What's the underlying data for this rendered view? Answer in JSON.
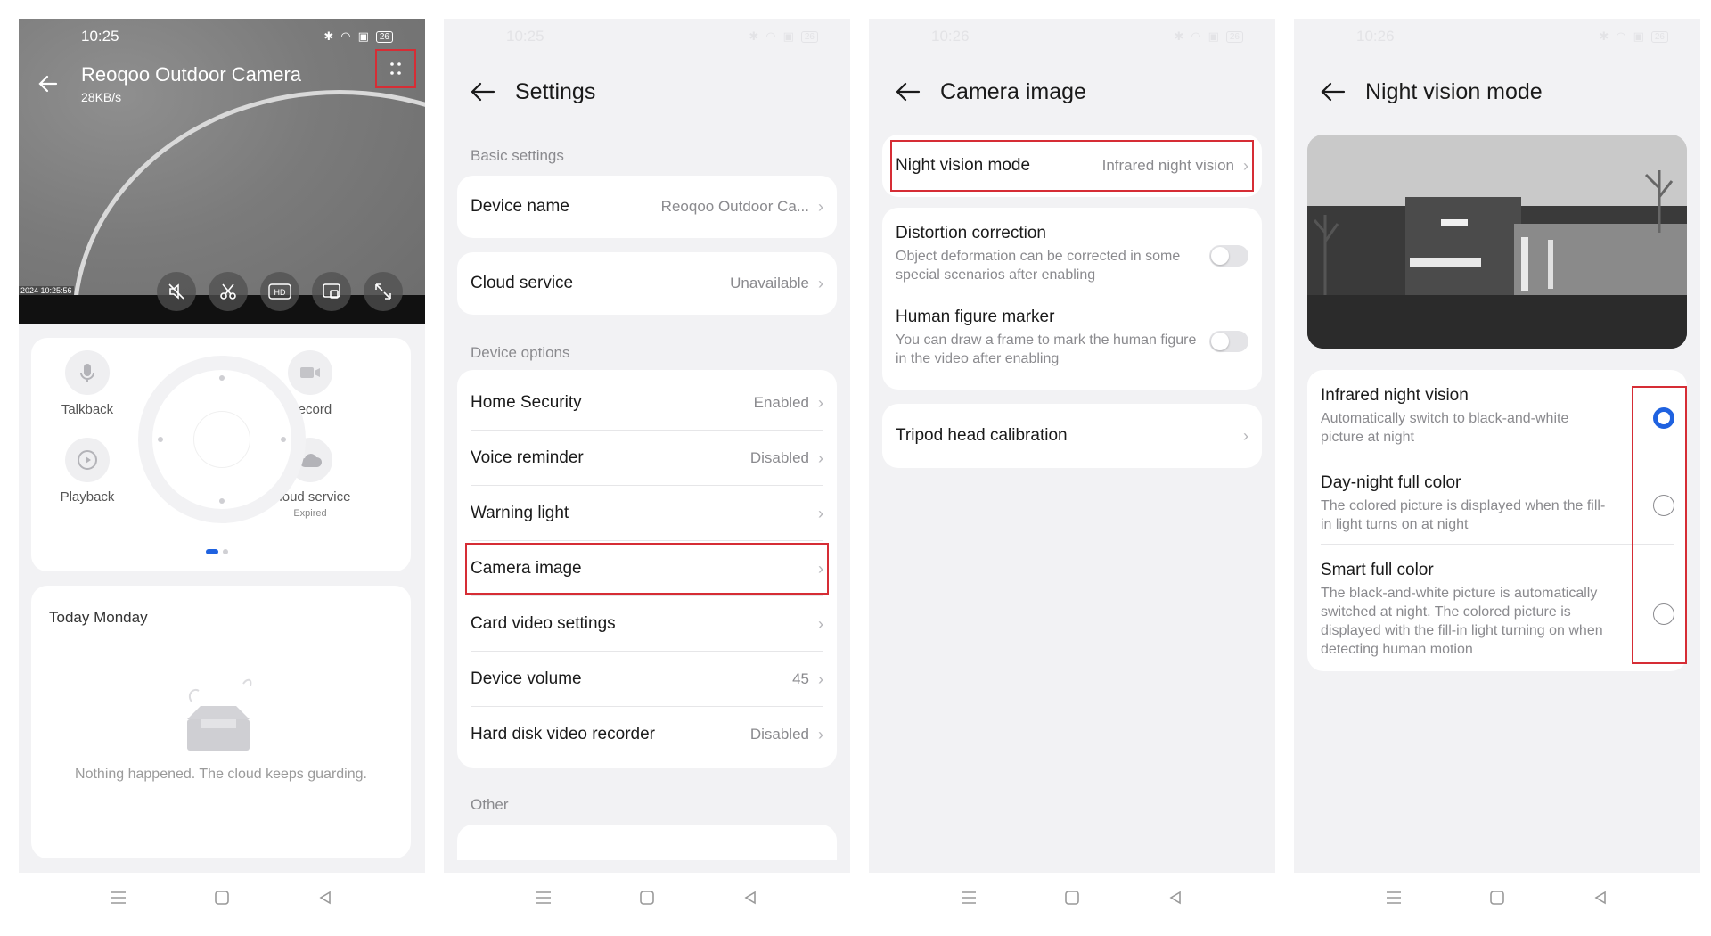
{
  "screen1": {
    "status": {
      "time": "10:25",
      "battery": "26"
    },
    "camera_title": "Reoqoo Outdoor Camera",
    "rate": "28KB/s",
    "timestamp": "2024  10:25:56",
    "hd_label": "HD",
    "features": {
      "talkback": "Talkback",
      "record": "Record",
      "playback": "Playback",
      "cloud_service": "Cloud service",
      "cloud_status": "Expired"
    },
    "today_label": "Today Monday",
    "empty_text": "Nothing happened. The cloud keeps guarding."
  },
  "screen2": {
    "status": {
      "time": "10:25",
      "battery": "26"
    },
    "title": "Settings",
    "section_basic": "Basic settings",
    "device_name": {
      "label": "Device name",
      "value": "Reoqoo Outdoor Ca..."
    },
    "cloud_service": {
      "label": "Cloud service",
      "value": "Unavailable"
    },
    "section_options": "Device options",
    "options": [
      {
        "label": "Home Security",
        "value": "Enabled"
      },
      {
        "label": "Voice reminder",
        "value": "Disabled"
      },
      {
        "label": "Warning light",
        "value": ""
      },
      {
        "label": "Camera image",
        "value": ""
      },
      {
        "label": "Card video settings",
        "value": ""
      },
      {
        "label": "Device volume",
        "value": "45"
      },
      {
        "label": "Hard disk video recorder",
        "value": "Disabled"
      }
    ],
    "section_other": "Other"
  },
  "screen3": {
    "status": {
      "time": "10:26",
      "battery": "26"
    },
    "title": "Camera image",
    "night_vision": {
      "label": "Night vision mode",
      "value": "Infrared night vision"
    },
    "distortion": {
      "label": "Distortion correction",
      "desc": "Object deformation can be corrected in some special scenarios after enabling"
    },
    "human_marker": {
      "label": "Human figure marker",
      "desc": "You can draw a frame to mark the human figure in the video after enabling"
    },
    "tripod": {
      "label": "Tripod head calibration"
    }
  },
  "screen4": {
    "status": {
      "time": "10:26",
      "battery": "26"
    },
    "title": "Night vision mode",
    "options": [
      {
        "label": "Infrared night vision",
        "desc": "Automatically switch to black-and-white picture at night",
        "selected": true
      },
      {
        "label": "Day-night full color",
        "desc": "The colored picture is displayed when the fill-in light turns on at night",
        "selected": false
      },
      {
        "label": "Smart full color",
        "desc": "The black-and-white picture is automatically switched at night. The colored picture is displayed with the fill-in light turning on when detecting human motion",
        "selected": false
      }
    ]
  },
  "colors": {
    "accent": "#1f62e0",
    "highlight": "#d62d35"
  }
}
